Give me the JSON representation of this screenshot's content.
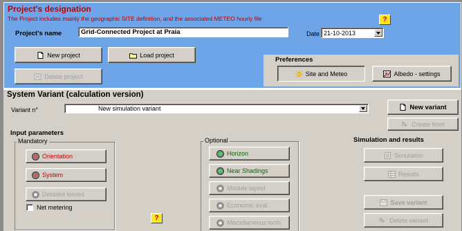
{
  "project": {
    "title": "Project's designation",
    "subtitle": "The Project includes mainly the geographic SITE definition, and the associated  METEO  hourly file",
    "help_label": "?",
    "name_label": "Project's name",
    "name_value": "Grid-Connected Project at Praia",
    "date_label": "Date",
    "date_value": "21-10-2013",
    "new_project_label": "New project",
    "load_project_label": "Load project",
    "delete_project_label": "Delete project",
    "preferences_label": "Preferences",
    "site_meteo_label": "Site and Meteo",
    "albedo_label": "Albedo - settings"
  },
  "variant": {
    "title": "System Variant (calculation version)",
    "variant_label": "Variant n°",
    "variant_value": "New simulation variant",
    "new_variant_label": "New variant",
    "create_from_label": "Create from",
    "input_params_label": "Input parameters",
    "mandatory_label": "Mandatory",
    "orientation_label": "Orientation",
    "system_label": "System",
    "detailed_losses_label": "Detailed losses",
    "net_metering_label": "Net metering",
    "help_label": "?",
    "optional_label": "Optional",
    "horizon_label": "Horizon",
    "near_shadings_label": "Near Shadings",
    "module_layout_label": "Module layout",
    "economic_label": "Economic eval.",
    "misc_tools_label": "Miscellaneous tools",
    "sim_results_label": "Simulation and results",
    "simulation_label": "Simulation",
    "results_label": "Results",
    "save_variant_label": "Save variant",
    "delete_variant_label": "Delete variant"
  },
  "colors": {
    "project_bg": "#6ea4e8",
    "panel_bg": "#d4d0c8",
    "title_red": "#c00000",
    "subtitle_red": "#b00000",
    "horizon_green": "#006a00",
    "help_yellow": "#ffe61e"
  }
}
